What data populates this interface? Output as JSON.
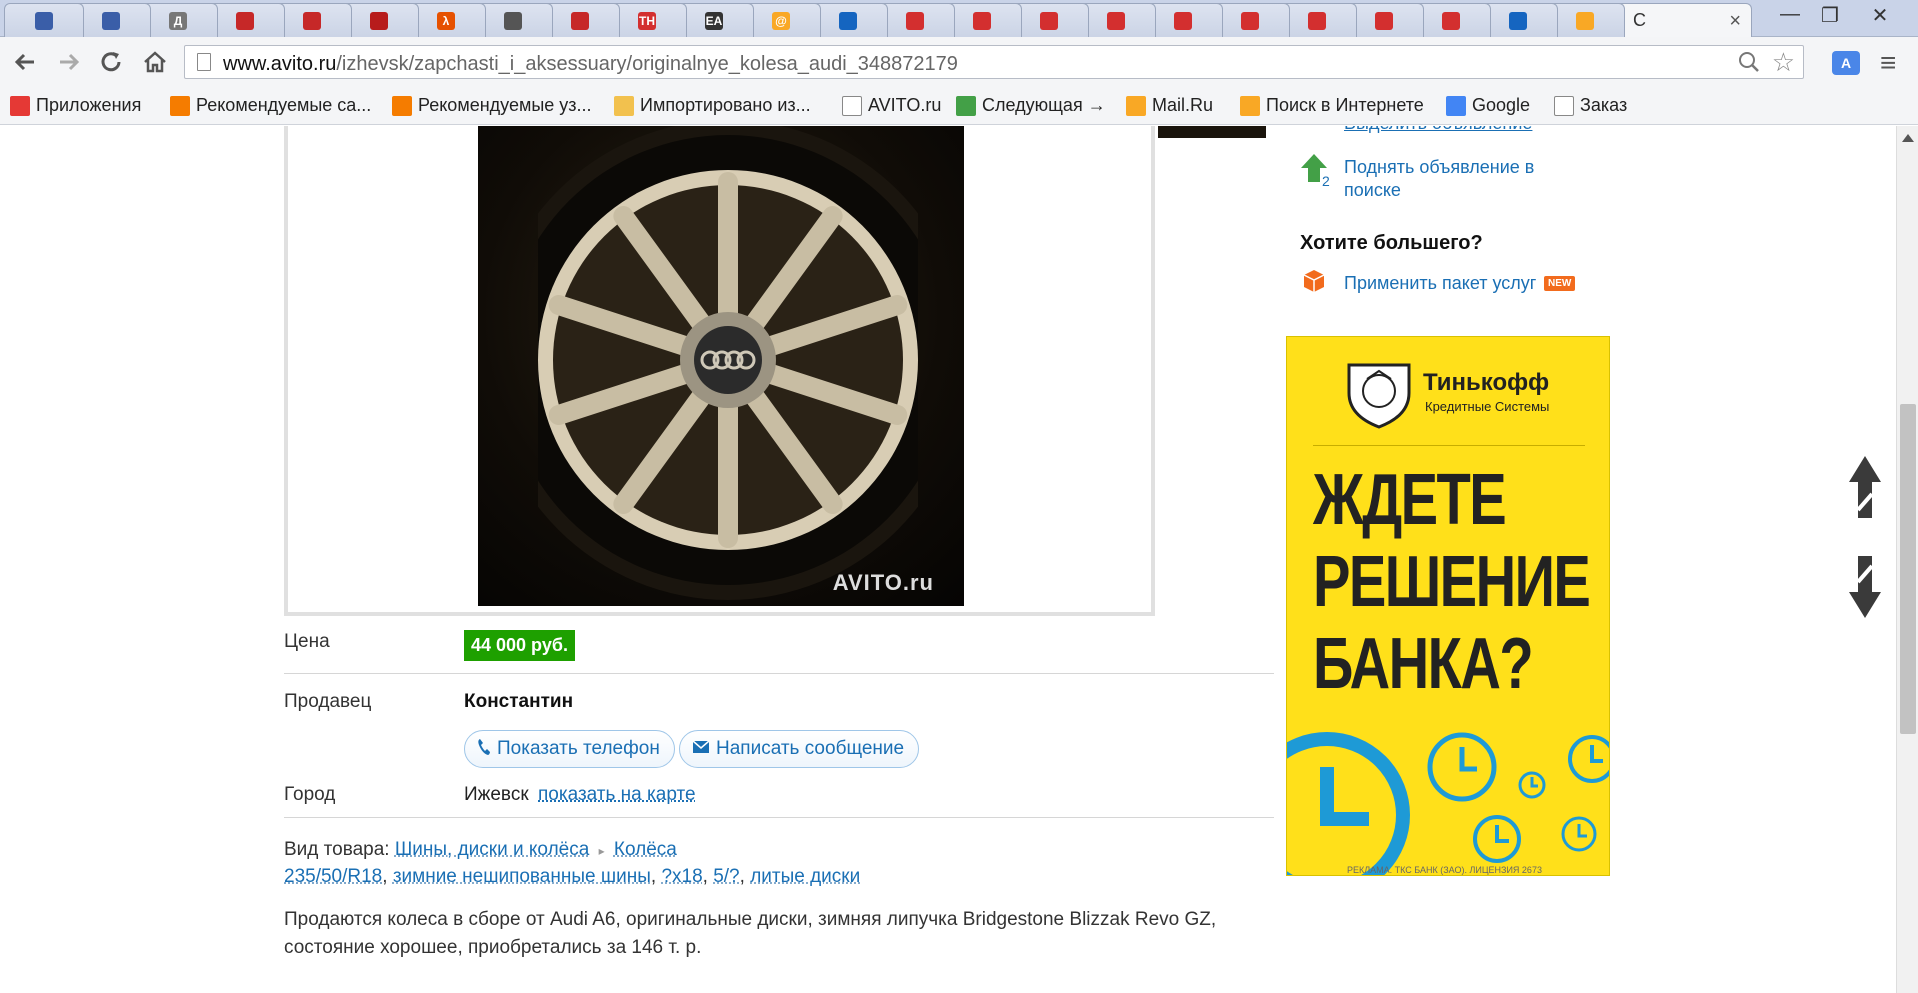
{
  "window": {
    "tabs": [
      {
        "name": "mail-tab-1",
        "label": "",
        "color": "#3a5ea8"
      },
      {
        "name": "mail-tab-2",
        "label": "",
        "color": "#3a5ea8"
      },
      {
        "name": "audio-tab",
        "label": "Д",
        "color": "#777777"
      },
      {
        "name": "audi-tab-1",
        "label": "",
        "color": "#c62828"
      },
      {
        "name": "audi-tab-2",
        "label": "",
        "color": "#c62828"
      },
      {
        "name": "warning-tab",
        "label": "",
        "color": "#b71c1c"
      },
      {
        "name": "lambda-tab",
        "label": "λ",
        "color": "#e65100"
      },
      {
        "name": "tv-tab",
        "label": "",
        "color": "#555555"
      },
      {
        "name": "car-tab",
        "label": "",
        "color": "#c62828"
      },
      {
        "name": "th-tab",
        "label": "TH",
        "color": "#d32f2f"
      },
      {
        "name": "ea-tab",
        "label": "EA",
        "color": "#333333"
      },
      {
        "name": "mailru-tab",
        "label": "@",
        "color": "#f9a825"
      },
      {
        "name": "bag-tab",
        "label": "",
        "color": "#1565c0"
      },
      {
        "name": "cart-tab-1",
        "label": "",
        "color": "#d32f2f"
      },
      {
        "name": "cart-tab-2",
        "label": "",
        "color": "#d32f2f"
      },
      {
        "name": "cart-tab-3",
        "label": "",
        "color": "#d32f2f"
      },
      {
        "name": "cart-tab-4",
        "label": "",
        "color": "#d32f2f"
      },
      {
        "name": "cart-tab-5",
        "label": "",
        "color": "#d32f2f"
      },
      {
        "name": "cart-tab-6",
        "label": "",
        "color": "#d32f2f"
      },
      {
        "name": "cart-tab-7",
        "label": "",
        "color": "#d32f2f"
      },
      {
        "name": "cart-tab-8",
        "label": "",
        "color": "#d32f2f"
      },
      {
        "name": "cart-tab-9",
        "label": "",
        "color": "#d32f2f"
      },
      {
        "name": "bag-tab-2",
        "label": "",
        "color": "#1565c0"
      },
      {
        "name": "search-tab",
        "label": "",
        "color": "#f9a825"
      }
    ],
    "active_tab_label": "С",
    "controls": {
      "minimize": "—",
      "maximize": "❐",
      "close": "✕"
    }
  },
  "toolbar": {
    "url_host": "www.avito.ru",
    "url_path": "/izhevsk/zapchasti_i_aksessuary/originalnye_kolesa_audi_348872179"
  },
  "bookmarks": [
    {
      "label": "Приложения",
      "icon": "apps-grid-icon",
      "color": "#e53935"
    },
    {
      "label": "Рекомендуемые са...",
      "icon": "bookmark-icon",
      "color": "#f57c00"
    },
    {
      "label": "Рекомендуемые уз...",
      "icon": "bookmark-icon",
      "color": "#f57c00"
    },
    {
      "label": "Импортировано из...",
      "icon": "folder-icon",
      "color": "#f2c14e"
    },
    {
      "label": "AVITO.ru",
      "icon": "page-icon",
      "color": "#ffffff"
    },
    {
      "label": "Следующая →",
      "icon": "colorful-dots-icon",
      "color": "#43a047"
    },
    {
      "label": "Mail.Ru",
      "icon": "at-icon",
      "color": "#f9a825"
    },
    {
      "label": "Поиск в Интернете",
      "icon": "search-icon",
      "color": "#f9a825"
    },
    {
      "label": "Google",
      "icon": "google-icon",
      "color": "#4285f4"
    },
    {
      "label": "Заказ",
      "icon": "page-icon",
      "color": "#ffffff"
    }
  ],
  "photo": {
    "watermark": "AVITO.ru"
  },
  "listing": {
    "price_label": "Цена",
    "price": "44 000 руб.",
    "seller_label": "Продавец",
    "seller_name": "Константин",
    "show_phone": "Показать телефон",
    "write_message": "Написать сообщение",
    "city_label": "Город",
    "city": "Ижевск",
    "map_link": "показать на карте",
    "category_label": "Вид товара:",
    "category_1": "Шины, диски и колёса",
    "category_2": "Колёса",
    "spec_size": "235/50/R18",
    "spec_season": "зимние нешипованные шины",
    "spec_rim": "?x18",
    "spec_bolts": "5/?",
    "spec_type": "литые диски",
    "description_1": "Продаются колеса в сборе от Audi A6, оригинальные диски, зимняя липучка Bridgestone Blizzak Revo GZ,",
    "description_2": "состояние хорошее, приобретались за 146 т. р."
  },
  "sidebar": {
    "cut_link": "Выделить объявление",
    "raise_link_1": "Поднять объявление в",
    "raise_link_2": "поиске",
    "more_title": "Хотите большего?",
    "package_link": "Применить пакет услуг",
    "new_badge": "NEW"
  },
  "ad": {
    "brand": "Тинькофф",
    "brand_sub": "Кредитные Системы",
    "line_1": "ЖДЕТЕ",
    "line_2": "РЕШЕНИЕ",
    "line_3": "БАНКА?",
    "footer": "РЕКЛАМА. ТКС БАНК (ЗАО). ЛИЦЕНЗИЯ 2673"
  }
}
